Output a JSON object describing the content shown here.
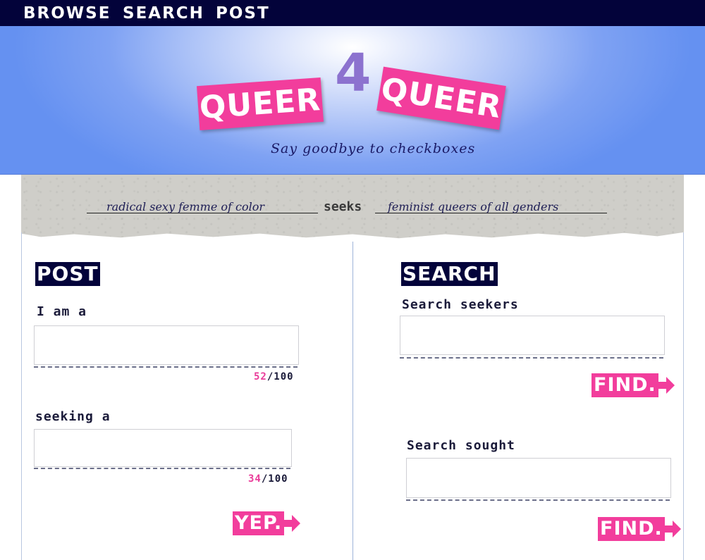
{
  "nav": {
    "browse": "BROWSE",
    "search": "SEARCH",
    "post": "POST"
  },
  "banner": {
    "logo_left": "QUEER",
    "logo_four": "4",
    "logo_right": "QUEER",
    "tagline": "Say goodbye to checkboxes"
  },
  "example": {
    "left": "radical sexy femme of color",
    "middle": "seeks",
    "right": "feminist queers of all genders"
  },
  "post": {
    "title": "POST",
    "iam_label": "I am a",
    "iam_value": "",
    "iam_count": "52",
    "iam_max": "/100",
    "seeking_label": "seeking a",
    "seeking_value": "",
    "seeking_count": "34",
    "seeking_max": "/100",
    "submit_label": "YEP."
  },
  "search": {
    "title": "SEARCH",
    "seekers_label": "Search seekers",
    "seekers_value": "",
    "find1_label": "FIND.",
    "sought_label": "Search sought",
    "sought_value": "",
    "find2_label": "FIND."
  },
  "colors": {
    "nav_bg": "#03033a",
    "accent_pink": "#f23d9c",
    "logo_four_purple": "#8c72cf",
    "banner_blue": "#6591f1"
  },
  "icons": {
    "button_arrow": "arrow-right-icon"
  }
}
